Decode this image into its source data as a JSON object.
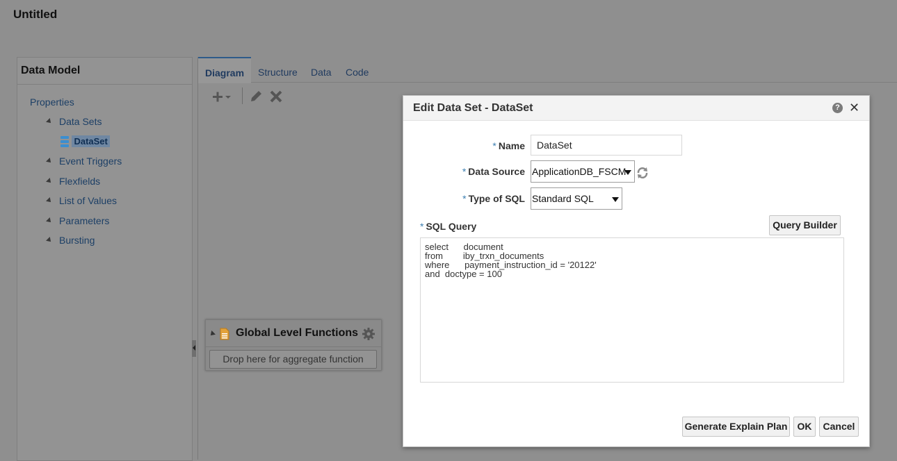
{
  "page": {
    "title": "Untitled"
  },
  "left_panel": {
    "title": "Data Model",
    "items": {
      "properties": "Properties",
      "data_sets": "Data Sets",
      "dataset": "DataSet",
      "event_triggers": "Event Triggers",
      "flexfields": "Flexfields",
      "list_of_values": "List of Values",
      "parameters": "Parameters",
      "bursting": "Bursting"
    }
  },
  "tabs": [
    "Diagram",
    "Structure",
    "Data",
    "Code"
  ],
  "active_tab": "Diagram",
  "toolbar_icons": [
    "add-icon",
    "dropdown-icon",
    "edit-icon",
    "delete-icon"
  ],
  "global_functions": {
    "title": "Global Level Functions",
    "drop_hint": "Drop here for aggregate function"
  },
  "dialog": {
    "title": "Edit Data Set - DataSet",
    "help": "?",
    "close": "✕",
    "required_marker": "*",
    "name_label": "Name",
    "name_value": "DataSet",
    "data_source_label": "Data Source",
    "data_source_value": "ApplicationDB_FSCM",
    "type_of_sql_label": "Type of SQL",
    "type_of_sql_value": "Standard SQL",
    "sql_query_label": "SQL Query",
    "query_builder_button": "Query Builder",
    "sql_text": "select      document\nfrom        iby_trxn_documents\nwhere      payment_instruction_id = '20122'\nand  doctype = 100",
    "buttons": {
      "explain_plan": "Generate Explain Plan",
      "ok": "OK",
      "cancel": "Cancel"
    }
  },
  "colors": {
    "overlay_bg": "#8f8f8f",
    "link": "#1c3f66",
    "required": "#3c7fb1",
    "dialog_header": "#f3f3f3"
  }
}
